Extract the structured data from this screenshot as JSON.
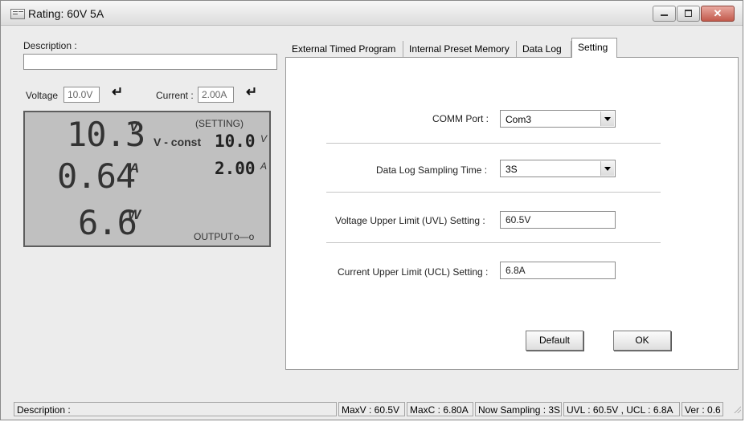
{
  "window": {
    "title": "Rating: 60V 5A"
  },
  "left": {
    "description_label": "Description :",
    "description_value": "",
    "voltage_label": "Voltage",
    "voltage_value": "10.0V",
    "current_label": "Current :",
    "current_value": "2.00A",
    "lcd": {
      "voltage_reading": "10.3",
      "voltage_unit": "V",
      "current_reading": "0.64",
      "current_unit": "A",
      "power_reading": "6.6",
      "power_unit": "W",
      "setting_label": "(SETTING)",
      "mode": "V - const",
      "set_voltage": "10.0",
      "set_voltage_unit": "V",
      "set_current": "2.00",
      "set_current_unit": "A",
      "output_label": "OUTPUT",
      "output_switch_symbol": "o—o"
    }
  },
  "tabs": [
    "External Timed Program",
    "Internal Preset Memory",
    "Data Log",
    "Setting"
  ],
  "active_tab": "Setting",
  "settings": {
    "comm_port_label": "COMM Port :",
    "comm_port_value": "Com3",
    "sampling_label": "Data Log Sampling Time :",
    "sampling_value": "3S",
    "uvl_label": "Voltage Upper Limit (UVL) Setting :",
    "uvl_value": "60.5V",
    "ucl_label": "Current Upper Limit (UCL) Setting :",
    "ucl_value": "6.8A",
    "default_button": "Default",
    "ok_button": "OK"
  },
  "statusbar": {
    "description": "Description :",
    "maxv": "MaxV : 60.5V",
    "maxc": "MaxC : 6.80A",
    "sampling": "Now Sampling : 3S",
    "limits": "UVL : 60.5V , UCL : 6.8A",
    "version": "Ver : 0.6"
  },
  "icons": {
    "enter": "enter-arrow-icon",
    "minimize": "minimize-icon",
    "maximize": "maximize-icon",
    "close": "close-icon"
  },
  "colors": {
    "lcd_background": "#c0c0c0",
    "close_button": "#c25a4c"
  }
}
